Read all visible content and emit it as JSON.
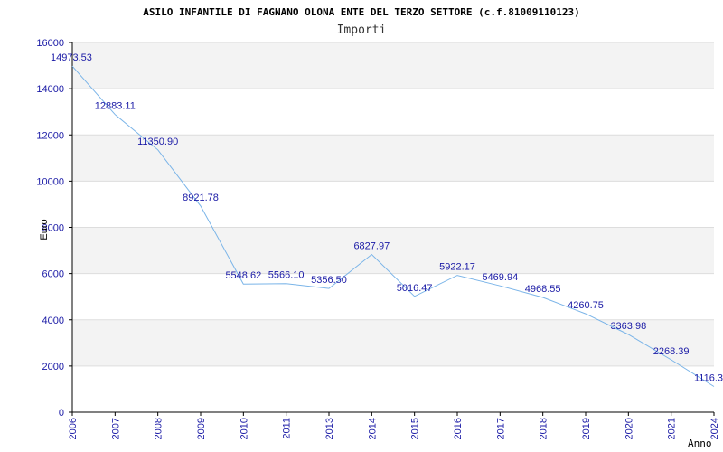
{
  "chart_data": {
    "type": "line",
    "title": "ASILO INFANTILE DI FAGNANO OLONA ENTE DEL TERZO SETTORE (c.f.81009110123)",
    "subtitle": "Importi",
    "xlabel": "Anno",
    "ylabel": "Euro",
    "x": [
      "2006",
      "2007",
      "2008",
      "2009",
      "2010",
      "2011",
      "2013",
      "2014",
      "2015",
      "2016",
      "2017",
      "2018",
      "2019",
      "2020",
      "2021",
      "2024"
    ],
    "series": [
      {
        "values": [
          14973.53,
          12883.11,
          11350.9,
          8921.78,
          5548.62,
          5566.1,
          5356.5,
          6827.97,
          5016.47,
          5922.17,
          5469.94,
          4968.55,
          4260.75,
          3363.98,
          2268.39,
          1116.3
        ],
        "labels": [
          "14973.53",
          "12883.11",
          "11350.90",
          "8921.78",
          "5548.62",
          "5566.10",
          "5356.50",
          "6827.97",
          "5016.47",
          "5922.17",
          "5469.94",
          "4968.55",
          "4260.75",
          "3363.98",
          "2268.39",
          "1116.3"
        ]
      }
    ],
    "ylim": [
      0,
      16000
    ],
    "yticks": [
      0,
      2000,
      4000,
      6000,
      8000,
      10000,
      12000,
      14000,
      16000
    ],
    "grid": true,
    "colors": {
      "line": "#7ab4e8",
      "band": "#f3f3f3",
      "grid": "#dddddd",
      "tick": "#1a1aa6"
    }
  }
}
